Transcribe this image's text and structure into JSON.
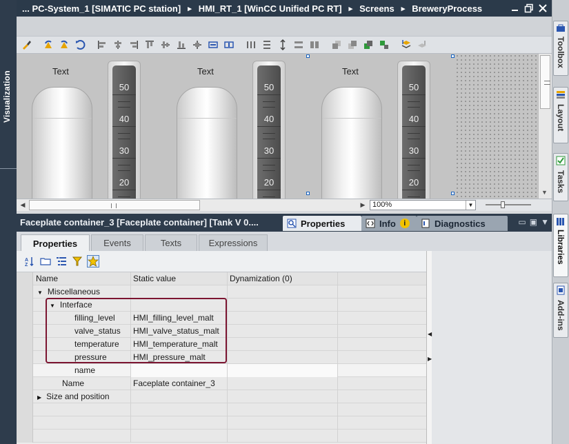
{
  "titlebar": {
    "crumbs": [
      "... PC-System_1 [SIMATIC PC station]",
      "HMI_RT_1 [WinCC Unified PC RT]",
      "Screens",
      "BreweryProcess"
    ],
    "separator": "▸"
  },
  "left_strip": {
    "label": "Visualization"
  },
  "right_strip": {
    "tabs": [
      "Toolbox",
      "Layout",
      "Tasks",
      "Libraries",
      "Add-ins"
    ]
  },
  "canvas": {
    "tanks": [
      {
        "label": "Text",
        "scale": [
          "50",
          "40",
          "30",
          "20"
        ]
      },
      {
        "label": "Text",
        "scale": [
          "50",
          "40",
          "30",
          "20"
        ]
      },
      {
        "label": "Text",
        "scale": [
          "50",
          "40",
          "30",
          "20"
        ]
      }
    ],
    "zoom": "100%"
  },
  "properties_panel": {
    "title": "Faceplate container_3 [Faceplate container] [Tank V 0....",
    "tabs": [
      "Properties",
      "Info",
      "Diagnostics"
    ],
    "info_badge": "i",
    "subtabs": [
      "Properties",
      "Events",
      "Texts",
      "Expressions"
    ],
    "columns": {
      "name": "Name",
      "static_value": "Static value",
      "dynamization": "Dynamization (0)"
    },
    "rows": [
      {
        "name": "Miscellaneous",
        "value": ""
      },
      {
        "name": "Interface",
        "value": ""
      },
      {
        "name": "filling_level",
        "value": "HMI_filling_level_malt"
      },
      {
        "name": "valve_status",
        "value": "HMI_valve_status_malt"
      },
      {
        "name": "temperature",
        "value": "HMI_temperature_malt"
      },
      {
        "name": "pressure",
        "value": "HMI_pressure_malt"
      },
      {
        "name": "name",
        "value": ""
      },
      {
        "name": "Name",
        "value": "Faceplate container_3"
      },
      {
        "name": "Size and position",
        "value": ""
      }
    ]
  },
  "colors": {
    "titlebar_bg": "#2b3a4a",
    "highlight_border": "#7b1430",
    "selection_handle": "#1560bd"
  },
  "icons": [
    "brush-icon",
    "rotate-left-icon",
    "rotate-right-icon",
    "flip-icon",
    "align-left-icon",
    "align-center-icon",
    "align-right-icon",
    "align-top-icon",
    "align-middle-icon",
    "align-bottom-icon",
    "center-icon",
    "same-width-icon",
    "same-height-icon",
    "distribute-h-icon",
    "distribute-v-icon",
    "group-icon",
    "layer-icon",
    "sort-az-icon",
    "folder-icon",
    "list-icon",
    "filter-icon",
    "favorite-icon"
  ]
}
